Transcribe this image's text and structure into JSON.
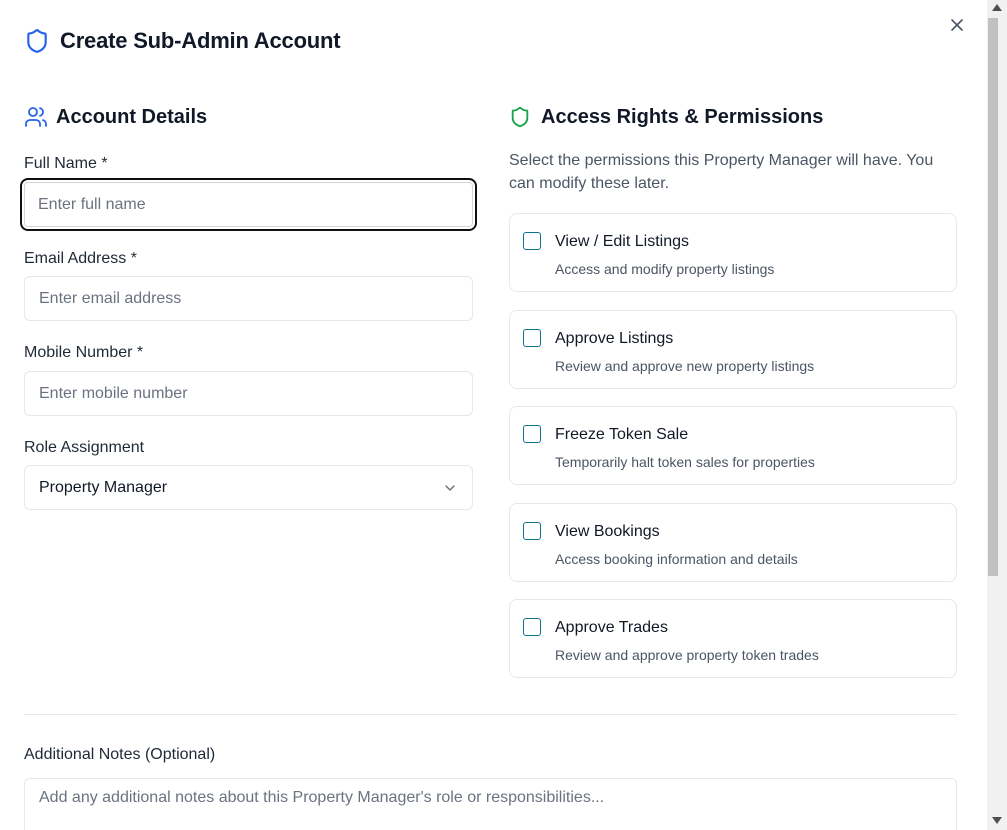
{
  "dialog": {
    "title": "Create Sub-Admin Account",
    "close_icon": "close-icon",
    "title_icon": "shield-icon"
  },
  "account": {
    "heading": "Account Details",
    "heading_icon": "users-icon",
    "full_name": {
      "label": "Full Name *",
      "placeholder": "Enter full name",
      "value": ""
    },
    "email": {
      "label": "Email Address *",
      "placeholder": "Enter email address",
      "value": ""
    },
    "mobile": {
      "label": "Mobile Number *",
      "placeholder": "Enter mobile number",
      "value": ""
    },
    "role": {
      "label": "Role Assignment",
      "selected": "Property Manager"
    }
  },
  "permissions": {
    "heading": "Access Rights & Permissions",
    "heading_icon": "shield-check-icon",
    "description": "Select the permissions this Property Manager will have. You can modify these later.",
    "items": [
      {
        "title": "View / Edit Listings",
        "subtitle": "Access and modify property listings",
        "checked": false
      },
      {
        "title": "Approve Listings",
        "subtitle": "Review and approve new property listings",
        "checked": false
      },
      {
        "title": "Freeze Token Sale",
        "subtitle": "Temporarily halt token sales for properties",
        "checked": false
      },
      {
        "title": "View Bookings",
        "subtitle": "Access booking information and details",
        "checked": false
      },
      {
        "title": "Approve Trades",
        "subtitle": "Review and approve property token trades",
        "checked": false
      }
    ]
  },
  "notes": {
    "label": "Additional Notes (Optional)",
    "placeholder": "Add any additional notes about this Property Manager's role or responsibilities...",
    "value": ""
  },
  "colors": {
    "accent_blue": "#2563eb",
    "accent_green": "#16a34a",
    "checkbox_border": "#0e7490"
  }
}
